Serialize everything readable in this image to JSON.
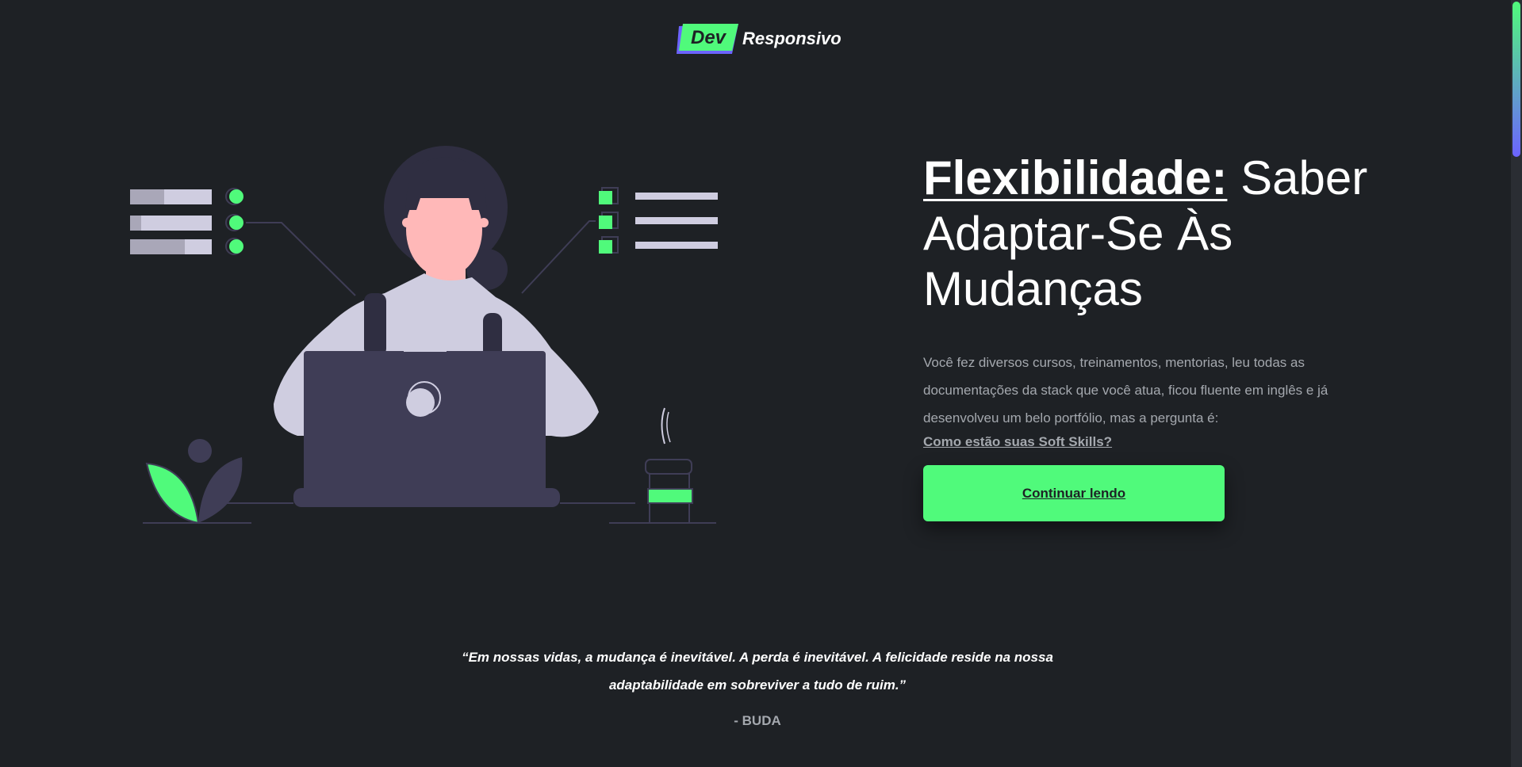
{
  "logo": {
    "badge": "Dev",
    "word": "Responsivo"
  },
  "hero": {
    "title_keyword": "Flexibilidade:",
    "title_rest": " Saber Adaptar-Se Às Mudanças",
    "description": "Você fez diversos cursos, treinamentos, mentorias, leu todas as documentações da stack que você atua, ficou fluente em inglês e já desenvolveu um belo portfólio, mas a pergunta é:",
    "link": "Como estão suas Soft Skills?",
    "cta_label": "Continuar lendo"
  },
  "quote": {
    "text": "“Em nossas vidas, a mudança é inevitável. A perda é inevitável. A felicidade reside na nossa adaptabilidade em sobreviver a tudo de ruim.”",
    "author": "- BUDA"
  },
  "colors": {
    "background": "#1e2125",
    "accent_green": "#50fa7b",
    "accent_purple": "#6c63ff",
    "muted_text": "#a4a8ae"
  }
}
